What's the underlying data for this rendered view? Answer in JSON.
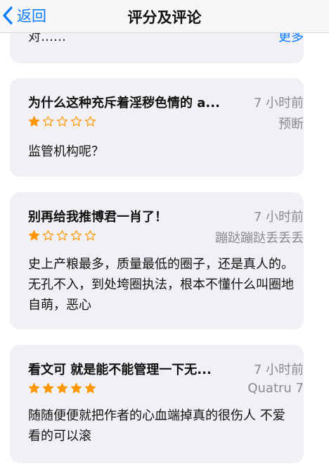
{
  "nav": {
    "back_label": "返回",
    "title": "评分及评论"
  },
  "top_card": {
    "truncated_text": "对……",
    "more_label": "更多"
  },
  "reviews": [
    {
      "title": "为什么这种充斥着淫秽色情的 a...",
      "time": "7 小时前",
      "author": "预断",
      "rating": 1,
      "body": "监管机构呢？"
    },
    {
      "title": "别再给我推博君一肖了！",
      "time": "7 小时前",
      "author": "蹦跶蹦跶丢丢丢",
      "rating": 1,
      "body": "史上产粮最多，质量最低的圈子，还是真人的。无孔不入，到处垮圈执法，根本不懂什么叫圈地自萌，恶心"
    },
    {
      "title": "看文可 就是能不能管理一下无...",
      "time": "7 小时前",
      "author": "Quatru 7",
      "rating": 5,
      "body": "随随便便就把作者的心血端掉真的很伤人 不爱看的可以滚"
    }
  ],
  "colors": {
    "accent": "#0a7aff",
    "star": "#ff9500",
    "card_bg": "#f1f1f5",
    "secondary_text": "#8a8a8f"
  }
}
